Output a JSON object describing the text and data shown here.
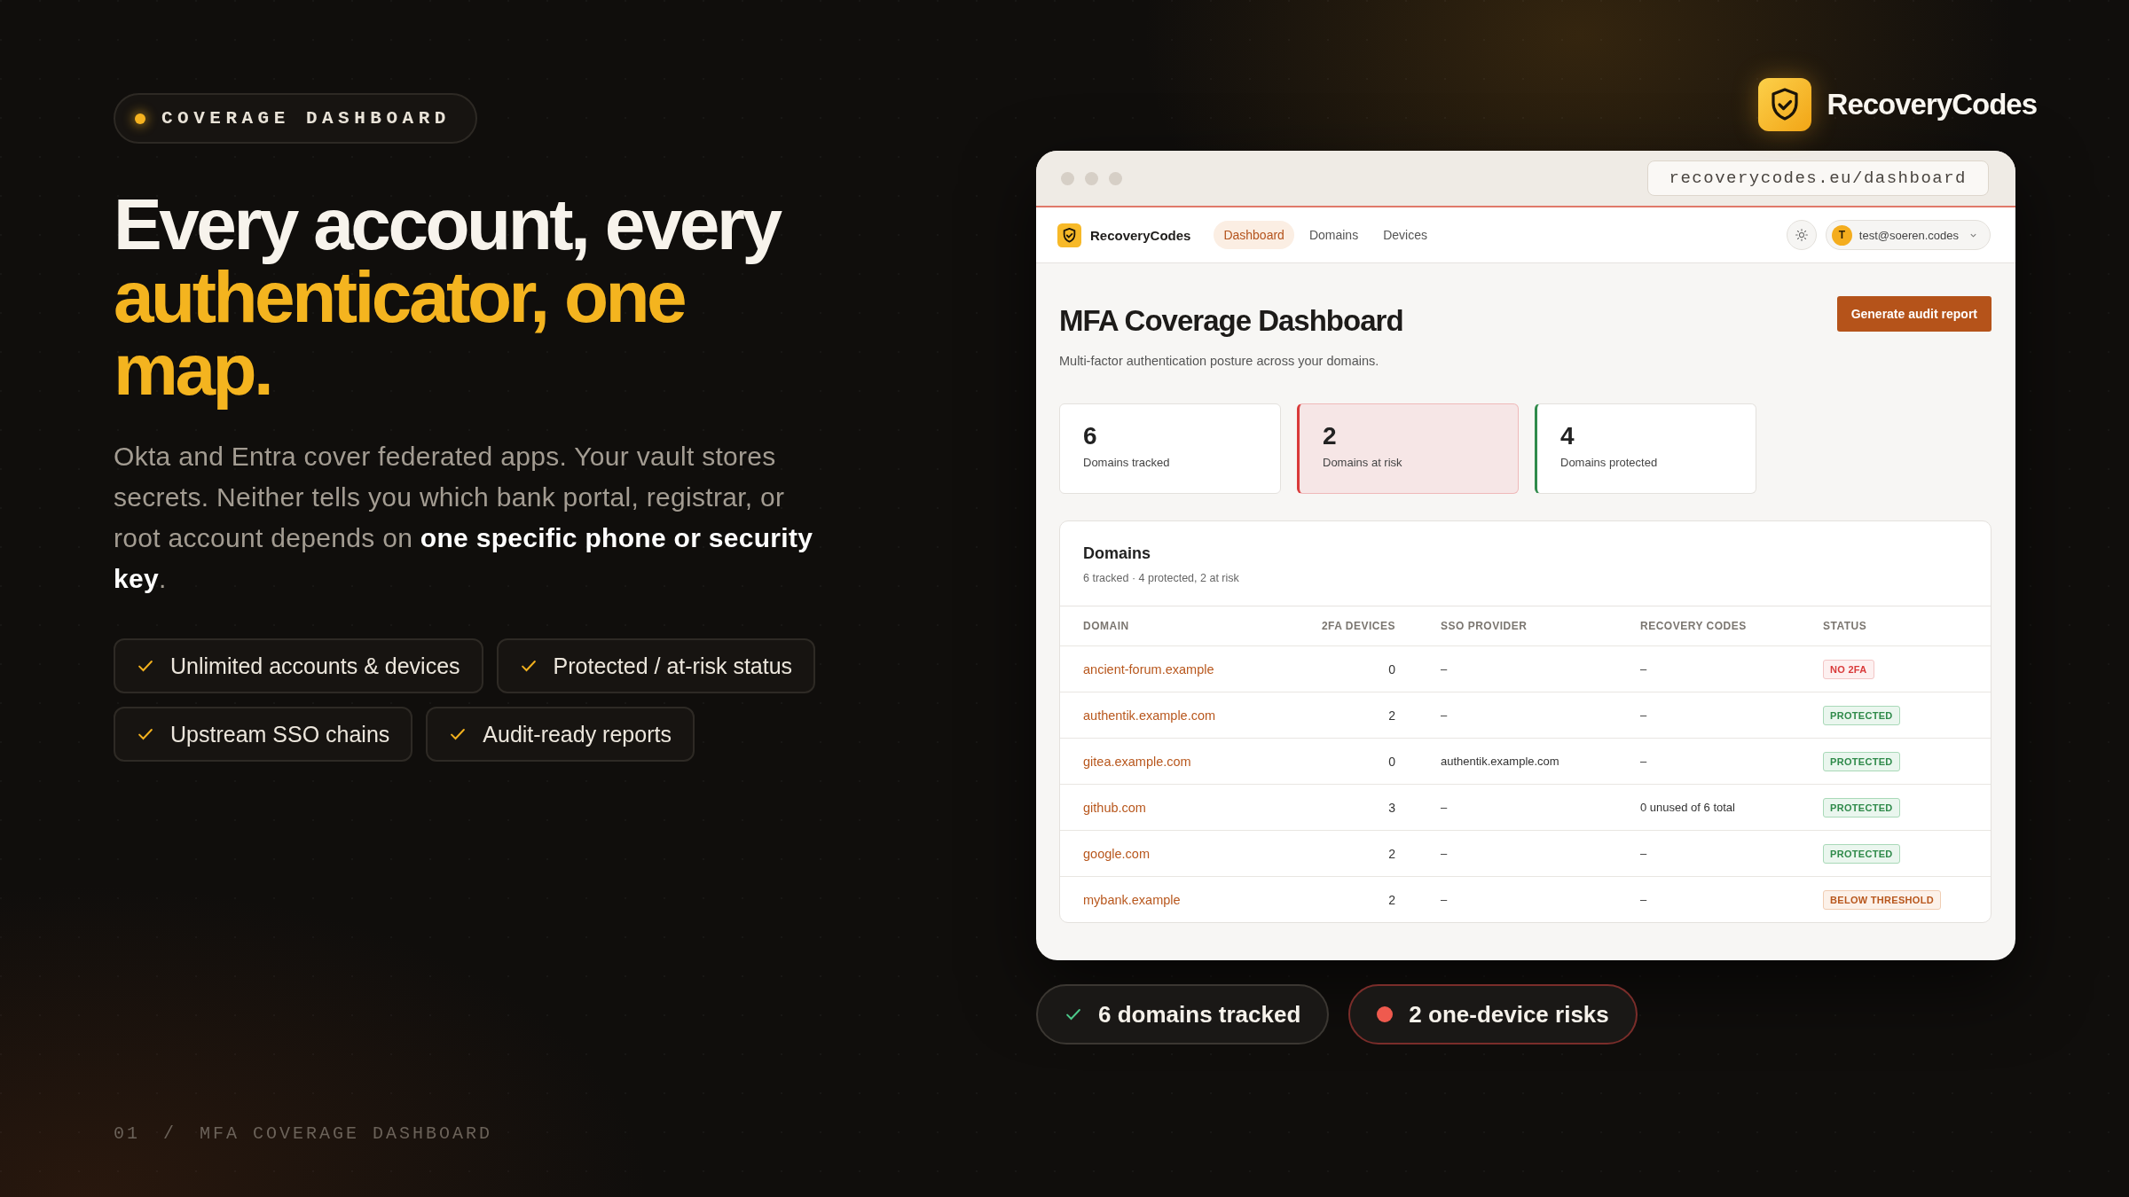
{
  "eyebrow": {
    "label": "COVERAGE DASHBOARD"
  },
  "headline": [
    {
      "text": "Every account, every",
      "accent": false
    },
    {
      "text": "authenticator, one",
      "accent": true
    },
    {
      "text": "map.",
      "accent": true
    }
  ],
  "intro": "Okta and Entra cover federated apps. Your vault stores secrets. Neither tells you which bank portal, registrar, or root account depends on **one specific phone or security key**.",
  "features": [
    [
      "Unlimited accounts & devices",
      "Protected / at-risk status"
    ],
    [
      "Upstream SSO chains",
      "Audit-ready reports"
    ]
  ],
  "footer": {
    "index": "01",
    "separator": "/",
    "title": "MFA COVERAGE DASHBOARD"
  },
  "brand": {
    "name": "RecoveryCodes"
  },
  "browser": {
    "url": "recoverycodes.eu/dashboard"
  },
  "nav": {
    "brand": "RecoveryCodes",
    "tabs": [
      {
        "label": "Dashboard",
        "selected": true
      },
      {
        "label": "Domains",
        "selected": false
      },
      {
        "label": "Devices",
        "selected": false
      }
    ],
    "user": {
      "initial": "T",
      "email": "test@soeren.codes"
    }
  },
  "page": {
    "title": "MFA Coverage Dashboard",
    "subtitle": "Multi-factor authentication posture across your domains.",
    "action": "Generate audit report"
  },
  "stats": [
    {
      "value": "6",
      "label": "Domains tracked",
      "kind": "neutral"
    },
    {
      "value": "2",
      "label": "Domains at risk",
      "kind": "risk"
    },
    {
      "value": "4",
      "label": "Domains protected",
      "kind": "protected"
    }
  ],
  "table": {
    "title": "Domains",
    "summary": "6 tracked · 4 protected, 2 at risk",
    "columns": [
      "DOMAIN",
      "2FA DEVICES",
      "SSO PROVIDER",
      "RECOVERY CODES",
      "STATUS"
    ],
    "rows": [
      {
        "domain": "ancient-forum.example",
        "devices": "0",
        "sso": "–",
        "recovery": "–",
        "status": {
          "label": "NO 2FA",
          "kind": "danger"
        }
      },
      {
        "domain": "authentik.example.com",
        "devices": "2",
        "sso": "–",
        "recovery": "–",
        "status": {
          "label": "PROTECTED",
          "kind": "ok"
        }
      },
      {
        "domain": "gitea.example.com",
        "devices": "0",
        "sso": "authentik.example.com",
        "recovery": "–",
        "status": {
          "label": "PROTECTED",
          "kind": "ok"
        }
      },
      {
        "domain": "github.com",
        "devices": "3",
        "sso": "–",
        "recovery": "0 unused of 6 total",
        "status": {
          "label": "PROTECTED",
          "kind": "ok"
        }
      },
      {
        "domain": "google.com",
        "devices": "2",
        "sso": "–",
        "recovery": "–",
        "status": {
          "label": "PROTECTED",
          "kind": "ok"
        }
      },
      {
        "domain": "mybank.example",
        "devices": "2",
        "sso": "–",
        "recovery": "–",
        "status": {
          "label": "BELOW THRESHOLD",
          "kind": "warn"
        }
      }
    ]
  },
  "badges": [
    {
      "label": "6 domains tracked",
      "kind": "ok"
    },
    {
      "label": "2 one-device risks",
      "kind": "risk"
    }
  ]
}
